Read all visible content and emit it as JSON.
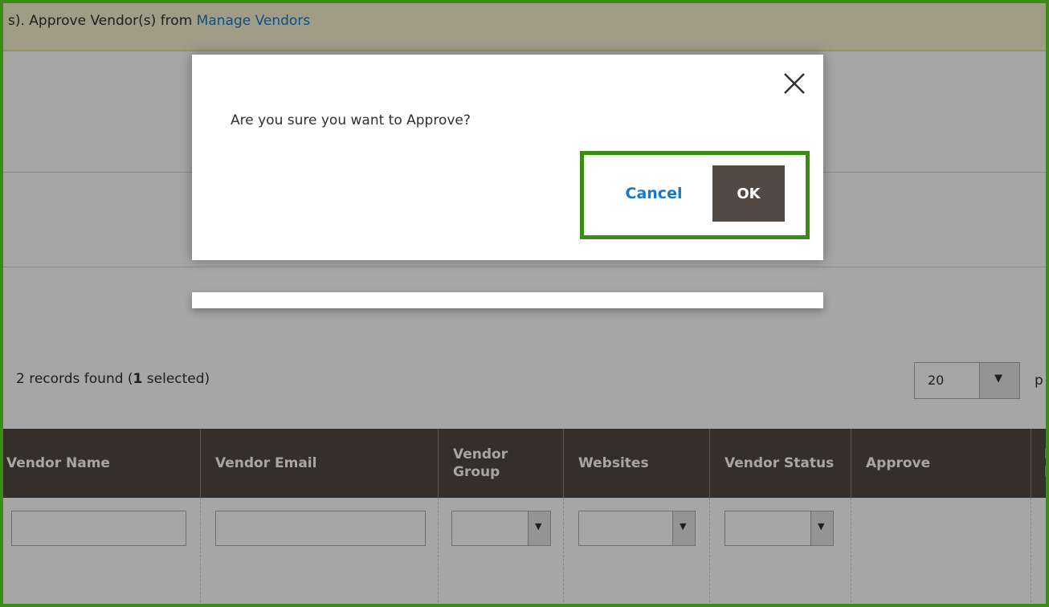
{
  "notice": {
    "text": "s). Approve Vendor(s) from ",
    "link_label": "Manage Vendors"
  },
  "grid": {
    "records_count_text": "2 records found (",
    "selected_count": "1",
    "selected_suffix": " selected)",
    "page_size": "20",
    "per_page_partial": "p",
    "columns": [
      "Vendor Name",
      "Vendor Email",
      "Vendor Group",
      "Websites",
      "Vendor Status",
      "Approve",
      "D F"
    ]
  },
  "dialog": {
    "message": "Are you sure you want to Approve?",
    "cancel_label": "Cancel",
    "ok_label": "OK"
  },
  "colors": {
    "highlight": "#3d8a14",
    "link": "#1979c3",
    "header_bg": "#514943",
    "notice_bg": "#f6f1cf"
  },
  "icons": {
    "close": "close-icon",
    "dropdown": "chevron-down-icon"
  }
}
